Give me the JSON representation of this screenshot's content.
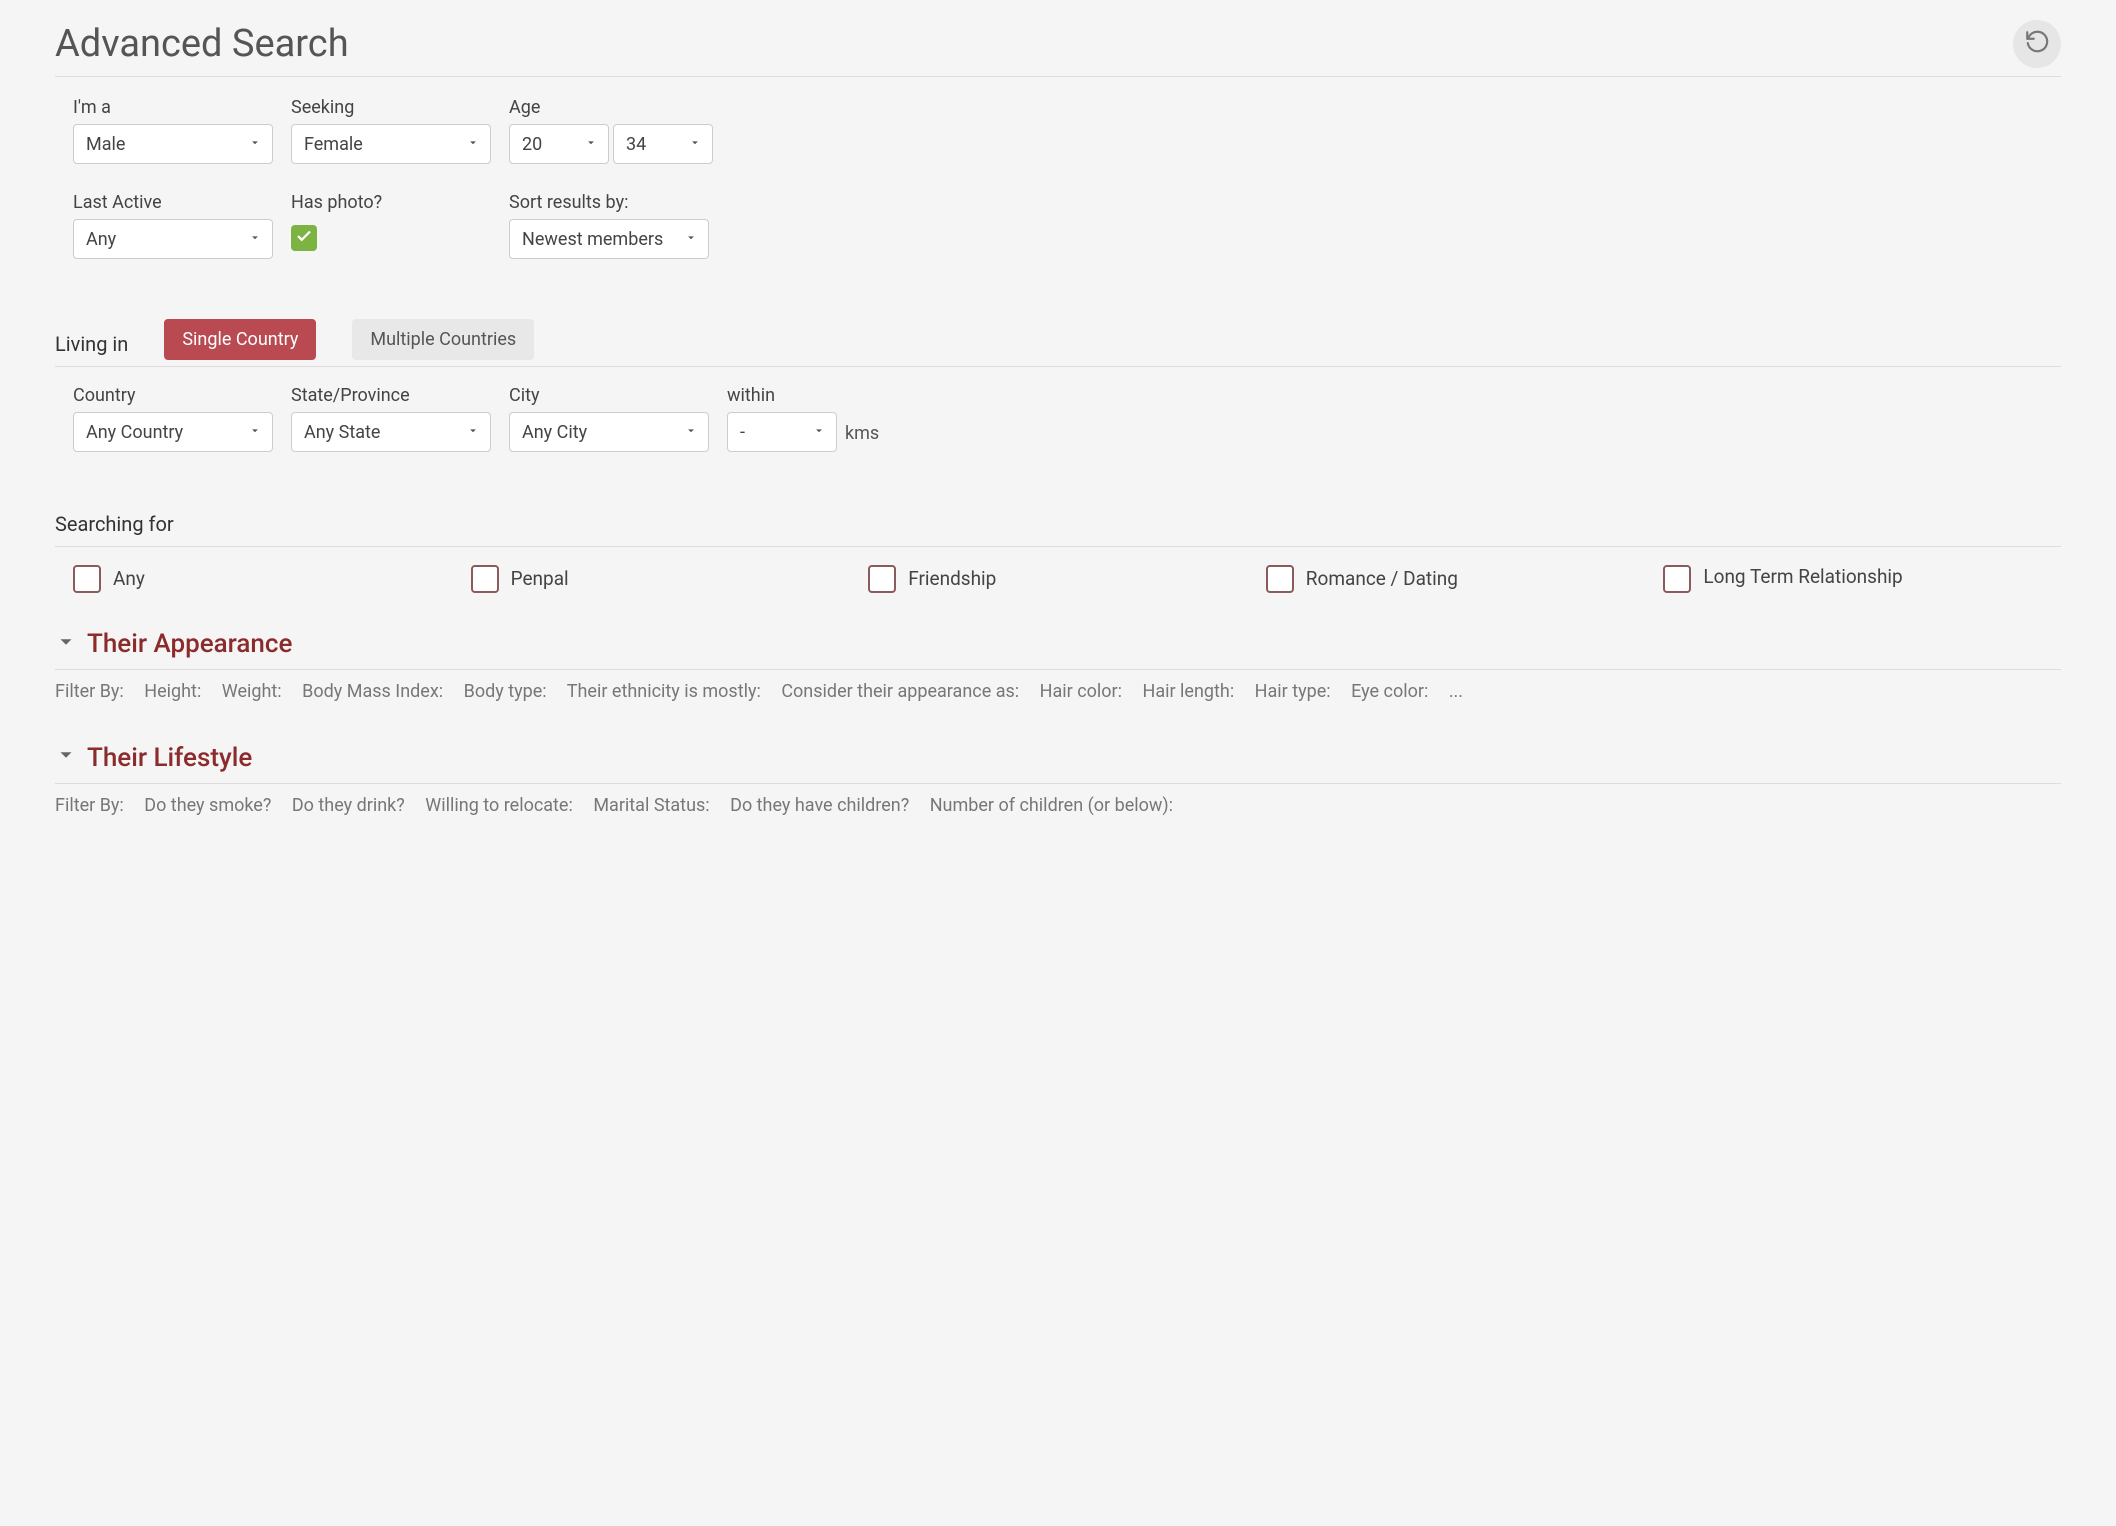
{
  "header": {
    "title": "Advanced Search"
  },
  "fields": {
    "im_a": {
      "label": "I'm a",
      "value": "Male"
    },
    "seeking": {
      "label": "Seeking",
      "value": "Female"
    },
    "age": {
      "label": "Age",
      "from": "20",
      "to": "34"
    },
    "last_active": {
      "label": "Last Active",
      "value": "Any"
    },
    "has_photo": {
      "label": "Has photo?"
    },
    "sort_by": {
      "label": "Sort results by:",
      "value": "Newest members"
    }
  },
  "living_in": {
    "label": "Living in",
    "tabs": {
      "single": "Single Country",
      "multiple": "Multiple Countries"
    },
    "country": {
      "label": "Country",
      "value": "Any Country"
    },
    "state": {
      "label": "State/Province",
      "value": "Any State"
    },
    "city": {
      "label": "City",
      "value": "Any City"
    },
    "within": {
      "label": "within",
      "value": "-",
      "unit": "kms"
    }
  },
  "searching_for": {
    "label": "Searching for",
    "options": {
      "any": "Any",
      "penpal": "Penpal",
      "friendship": "Friendship",
      "romance": "Romance / Dating",
      "longterm": "Long Term Relationship"
    }
  },
  "appearance": {
    "title": "Their Appearance",
    "filter_by": "Filter By:",
    "filters": [
      "Height:",
      "Weight:",
      "Body Mass Index:",
      "Body type:",
      "Their ethnicity is mostly:",
      "Consider their appearance as:",
      "Hair color:",
      "Hair length:",
      "Hair type:",
      "Eye color:",
      "..."
    ]
  },
  "lifestyle": {
    "title": "Their Lifestyle",
    "filter_by": "Filter By:",
    "filters": [
      "Do they smoke?",
      "Do they drink?",
      "Willing to relocate:",
      "Marital Status:",
      "Do they have children?",
      "Number of children (or below):"
    ]
  }
}
